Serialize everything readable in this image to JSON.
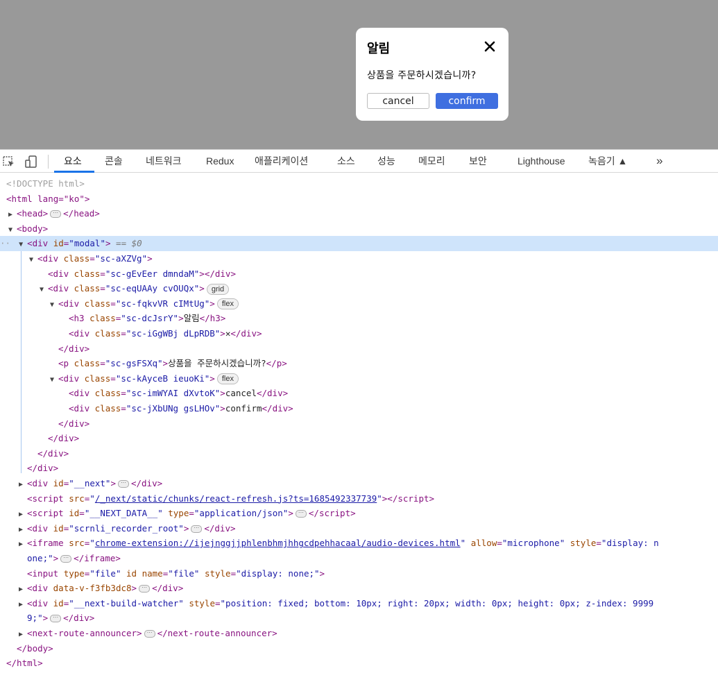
{
  "modal": {
    "title": "알림",
    "close_glyph": "✕",
    "message": "상품을 주문하시겠습니까?",
    "cancel_label": "cancel",
    "confirm_label": "confirm"
  },
  "devtools": {
    "tabs": [
      "요소",
      "콘솔",
      "네트워크",
      "Redux",
      "애플리케이션",
      "소스",
      "성능",
      "메모리",
      "보안",
      "Lighthouse",
      "녹음기 ▲",
      "»"
    ],
    "active_tab": "요소"
  },
  "tree": {
    "doctype": "<!DOCTYPE html>",
    "html_open": "<html lang=\"ko\">",
    "head": "<head>…</head>",
    "body_open": "<body>",
    "modal_div": "<div id=\"modal\">",
    "modal_div_suffix": "== $0",
    "class_a": "sc-aXZVg",
    "class_b": "sc-gEvEer dmndaM",
    "class_c": "sc-eqUAAy cvOUQx",
    "class_d": "sc-fqkvVR cIMtUg",
    "class_h3": "sc-dcJsrY",
    "h3_text": "알림",
    "class_x": "sc-iGgWBj dLpRDB",
    "x_text": "✕",
    "class_p": "sc-gsFSXq",
    "p_text": "상품을 주문하시겠습니까?",
    "class_e": "sc-kAyceB ieuoKi",
    "class_cancel": "sc-imWYAI dXvtoK",
    "cancel_text": "cancel",
    "class_confirm": "sc-jXbUNg gsLHOv",
    "confirm_text": "confirm",
    "badge_grid": "grid",
    "badge_flex": "flex",
    "next_id": "__next",
    "script_src": "/_next/static/chunks/react-refresh.js?ts=1685492337739",
    "next_data_id": "__NEXT_DATA__",
    "next_data_type": "application/json",
    "scrnli_id": "scrnli_recorder_root",
    "iframe_src": "chrome-extension://ijejnggjjphlenbhmjhhgcdpehhacaal/audio-devices.html",
    "iframe_allow": "microphone",
    "iframe_style_1": "display: n",
    "iframe_style_2": "one;",
    "input_type": "file",
    "input_name": "file",
    "input_style": "display: none;",
    "data_v_attr": "data-v-f3fb3dc8",
    "watcher_id": "__next-build-watcher",
    "watcher_style_1": "position: fixed; bottom: 10px; right: 20px; width: 0px; height: 0px; z-index: 9999",
    "watcher_style_2": "9;",
    "route_announcer": "next-route-announcer"
  }
}
